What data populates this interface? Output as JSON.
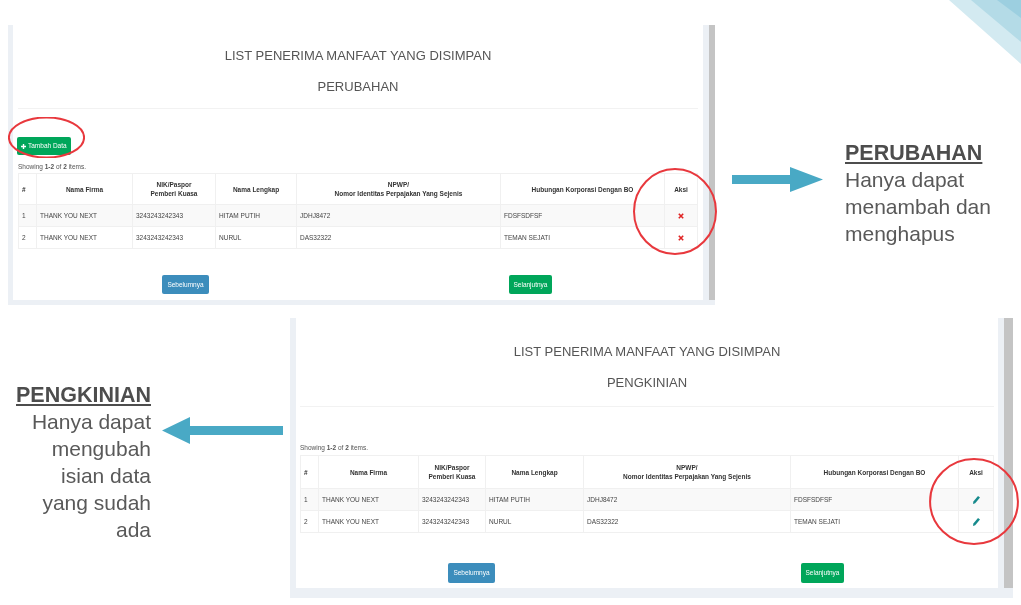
{
  "sections": [
    {
      "kind": "right",
      "screen": {
        "title": "LIST PENERIMA MANFAAT YANG DISIMPAN",
        "subtitle": "PERUBAHAN",
        "add_button": {
          "label": "Tambah Data",
          "highlighted": true
        },
        "summary": "Showing **1-2** of **2** items.",
        "table": {
          "kind": "delete",
          "columns": [
            "#",
            "Nama Firma",
            "NIK/Paspor\nPemberi Kuasa",
            "Nama Lengkap",
            "NPWP/\nNomor Identitas Perpajakan Yang Sejenis",
            "Hubungan Korporasi Dengan BO",
            "Aksi"
          ],
          "rows": [
            {
              "cells": [
                "1",
                "THANK YOU NEXT",
                "3243243242343",
                "HITAM PUTIH",
                "JDHJ8472",
                "FDSFSDFSF"
              ]
            },
            {
              "cells": [
                "2",
                "THANK YOU NEXT",
                "3243243242343",
                "NURUL",
                "DAS32322",
                "TEMAN SEJATI"
              ]
            }
          ],
          "actions_highlighted": true
        },
        "pager": {
          "previous": "Sebelumnya",
          "next": "Selanjutnya"
        }
      },
      "note": {
        "heading": "PERUBAHAN",
        "text": "Hanya dapat menambah dan menghapus"
      }
    },
    {
      "kind": "left",
      "note": {
        "heading": "PENGKINIAN",
        "text": "Hanya dapat mengubah isian data yang sudah ada"
      },
      "screen": {
        "title": "LIST PENERIMA MANFAAT YANG DISIMPAN",
        "subtitle": "PENGKINIAN",
        "summary": "Showing **1-2** of **2** items.",
        "table": {
          "kind": "edit",
          "columns": [
            "#",
            "Nama Firma",
            "NIK/Paspor\nPemberi Kuasa",
            "Nama Lengkap",
            "NPWP/\nNomor Identitas Perpajakan Yang Sejenis",
            "Hubungan Korporasi Dengan BO",
            "Aksi"
          ],
          "rows": [
            {
              "cells": [
                "1",
                "THANK YOU NEXT",
                "3243243242343",
                "HITAM PUTIH",
                "JDHJ8472",
                "FDSFSDFSF"
              ]
            },
            {
              "cells": [
                "2",
                "THANK YOU NEXT",
                "3243243242343",
                "NURUL",
                "DAS32322",
                "TEMAN SEJATI"
              ]
            }
          ],
          "actions_highlighted": true
        },
        "pager": {
          "previous": "Sebelumnya",
          "next": "Selanjutnya"
        }
      }
    }
  ]
}
